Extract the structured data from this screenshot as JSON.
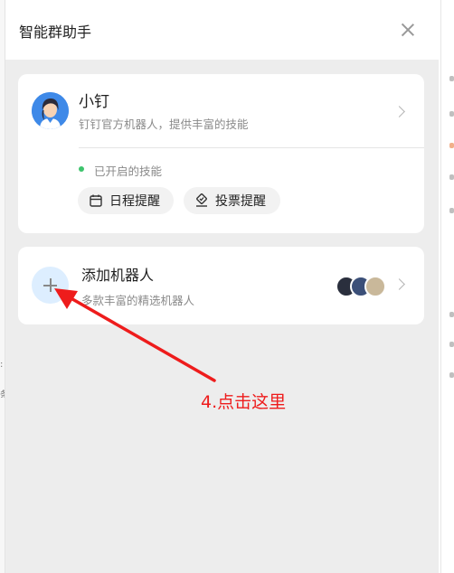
{
  "panel": {
    "title": "智能群助手"
  },
  "bot_card": {
    "name": "小钉",
    "description": "钉钉官方机器人，提供丰富的技能",
    "status": "已开启的技能",
    "skills": [
      {
        "label": "日程提醒",
        "icon": "calendar-icon"
      },
      {
        "label": "投票提醒",
        "icon": "vote-icon"
      }
    ]
  },
  "add_card": {
    "title": "添加机器人",
    "description": "多款丰富的精选机器人"
  },
  "annotation": {
    "text": "4.点击这里",
    "color": "#ee1c1c"
  },
  "colors": {
    "accent_blue": "#3e89e8",
    "status_green": "#3ec46d",
    "panel_bg": "#ededed"
  }
}
